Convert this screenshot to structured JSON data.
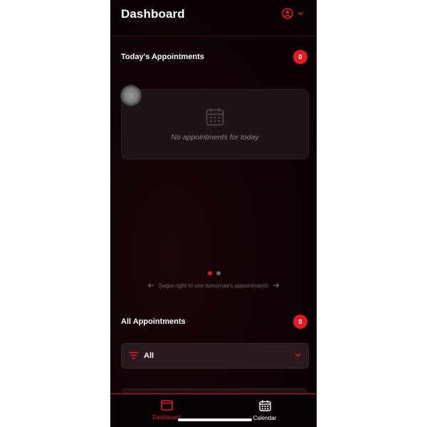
{
  "header": {
    "title": "Dashboard"
  },
  "today": {
    "title": "Today's Appointments",
    "count": "0",
    "empty_message": "No appointments for today",
    "swipe_hint": "Swipe right to see tomorrow's appointments",
    "page_dots": {
      "total": 2,
      "active": 1
    }
  },
  "all": {
    "title": "All Appointments",
    "count": "0",
    "filter": {
      "selected": "All"
    }
  },
  "tabs": [
    {
      "label": "Dashboard",
      "icon": "dashboard-icon",
      "active": true
    },
    {
      "label": "Calendar",
      "icon": "calendar-icon",
      "active": false
    }
  ],
  "colors": {
    "accent": "#e21a24",
    "background": "#0e0204",
    "card": "#1e1416",
    "muted_text": "#8a8587"
  }
}
